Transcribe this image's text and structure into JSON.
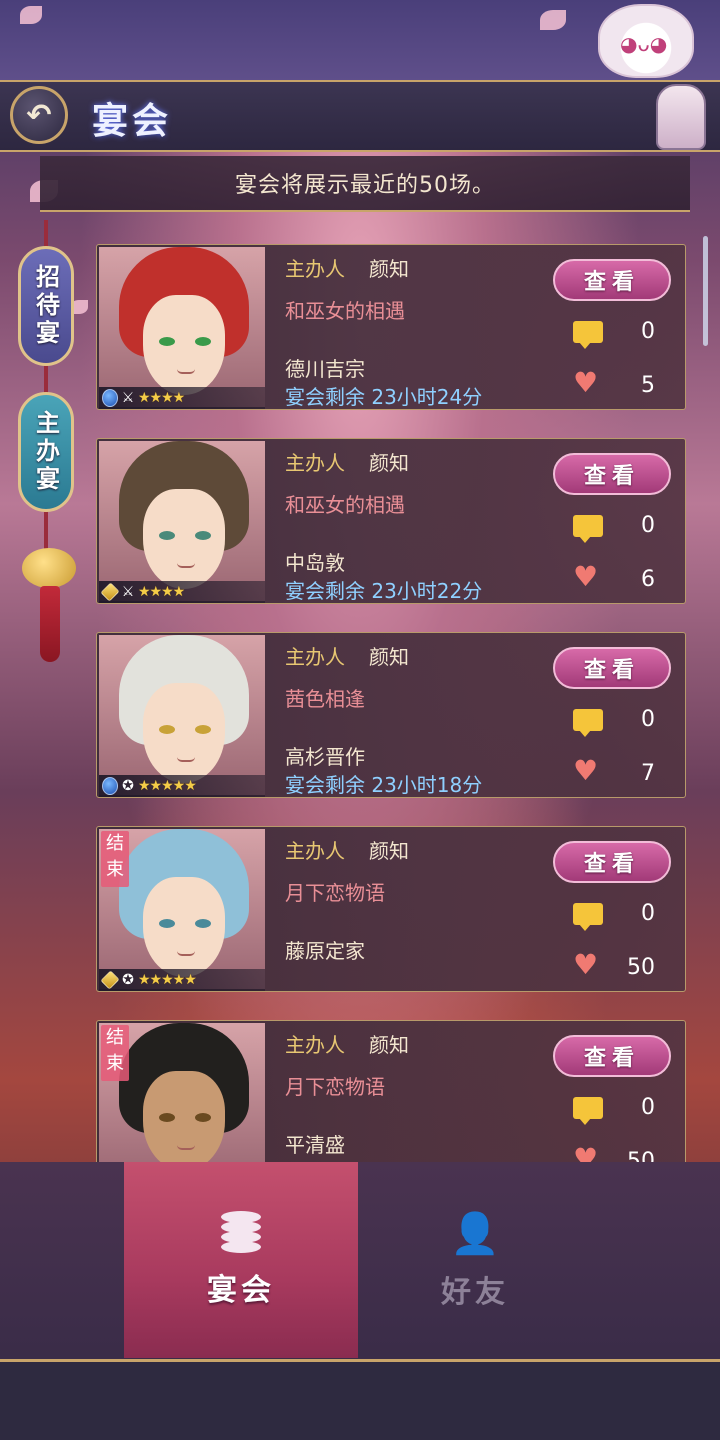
{
  "header": {
    "back_icon": "↶",
    "title": "宴会"
  },
  "notice": "宴会将展示最近的50场。",
  "side_tabs": {
    "invite": "招待宴",
    "host": "主办宴"
  },
  "colors": {
    "accent_gold": "#c8a46a",
    "host_label": "#e8c772",
    "story_text": "#e98f96",
    "remaining_text": "#8fd0ff",
    "view_button": "#c2508f"
  },
  "banquets": [
    {
      "host_label": "主办人",
      "host_name": "颜知",
      "story": "和巫女的相遇",
      "character": "德川吉宗",
      "remaining": "宴会剩余 23小时24分",
      "view_label": "查看",
      "comments": "0",
      "likes": "5",
      "ended": "",
      "gem": "blue",
      "class_icon": "⚔",
      "stars": "★★★★"
    },
    {
      "host_label": "主办人",
      "host_name": "颜知",
      "story": "和巫女的相遇",
      "character": "中岛敦",
      "remaining": "宴会剩余 23小时22分",
      "view_label": "查看",
      "comments": "0",
      "likes": "6",
      "ended": "",
      "gem": "gold",
      "class_icon": "⚔",
      "stars": "★★★★"
    },
    {
      "host_label": "主办人",
      "host_name": "颜知",
      "story": "茜色相逢",
      "character": "高杉晋作",
      "remaining": "宴会剩余 23小时18分",
      "view_label": "查看",
      "comments": "0",
      "likes": "7",
      "ended": "",
      "gem": "blue",
      "class_icon": "✪",
      "stars": "★★★★★"
    },
    {
      "host_label": "主办人",
      "host_name": "颜知",
      "story": "月下恋物语",
      "character": "藤原定家",
      "remaining": "",
      "view_label": "查看",
      "comments": "0",
      "likes": "50",
      "ended": "结束",
      "gem": "gold",
      "class_icon": "✪",
      "stars": "★★★★★"
    },
    {
      "host_label": "主办人",
      "host_name": "颜知",
      "story": "月下恋物语",
      "character": "平清盛",
      "remaining": "",
      "view_label": "查看",
      "comments": "0",
      "likes": "50",
      "ended": "结束",
      "gem": "gold",
      "class_icon": "✪",
      "stars": "★★★★★"
    }
  ],
  "bottom_nav": {
    "banquet": "宴会",
    "friends": "好友"
  }
}
